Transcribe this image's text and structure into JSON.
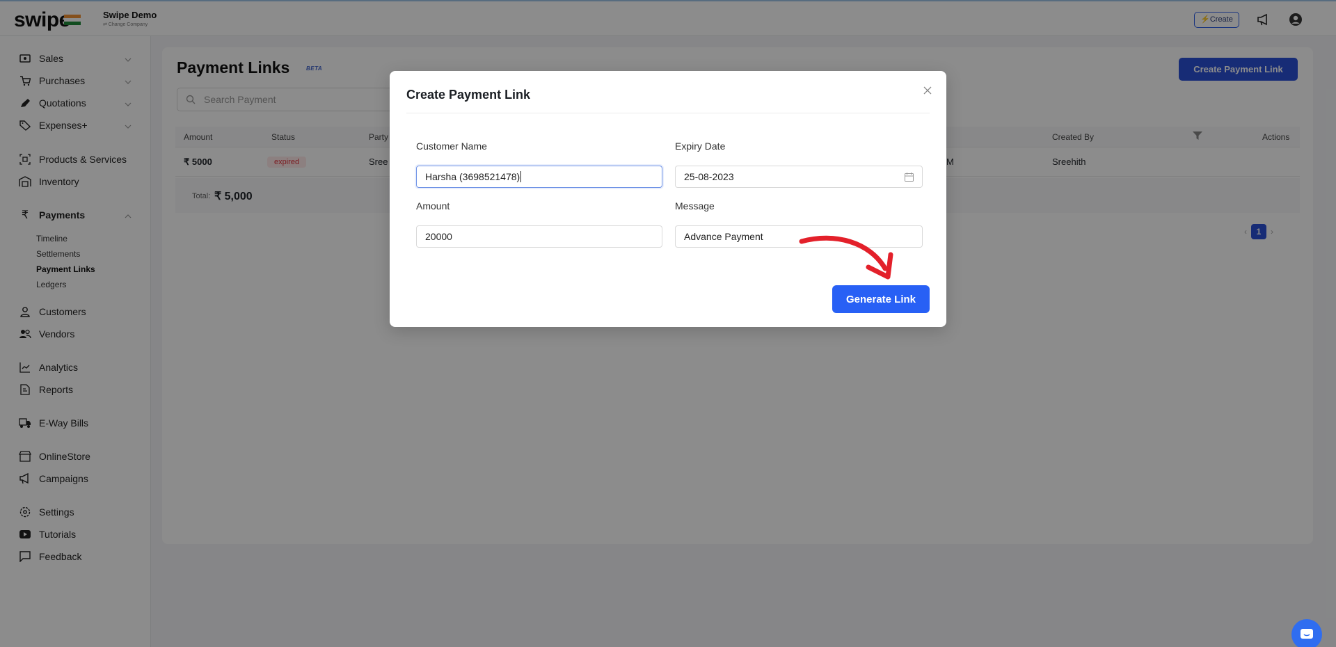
{
  "app": {
    "logo": "swipe",
    "company_name": "Swipe Demo",
    "change_company": "⇄ Change Company",
    "create_label": "⚡Create"
  },
  "sidebar": {
    "items": [
      {
        "label": "Sales",
        "icon": "cash-icon"
      },
      {
        "label": "Purchases",
        "icon": "cart-icon"
      },
      {
        "label": "Quotations",
        "icon": "pen-icon"
      },
      {
        "label": "Expenses+",
        "icon": "tag-icon"
      },
      {
        "label": "Products & Services",
        "icon": "box-icon"
      },
      {
        "label": "Inventory",
        "icon": "warehouse-icon"
      },
      {
        "label": "Payments",
        "icon": "rupee-icon"
      },
      {
        "label": "Customers",
        "icon": "user-icon"
      },
      {
        "label": "Vendors",
        "icon": "users-icon"
      },
      {
        "label": "Analytics",
        "icon": "chart-icon"
      },
      {
        "label": "Reports",
        "icon": "report-icon"
      },
      {
        "label": "E-Way Bills",
        "icon": "truck-icon"
      },
      {
        "label": "OnlineStore",
        "icon": "store-icon"
      },
      {
        "label": "Campaigns",
        "icon": "megaphone-icon"
      },
      {
        "label": "Settings",
        "icon": "gear-icon"
      },
      {
        "label": "Tutorials",
        "icon": "play-icon"
      },
      {
        "label": "Feedback",
        "icon": "chat-icon"
      }
    ],
    "payments_sub": [
      "Timeline",
      "Settlements",
      "Payment Links",
      "Ledgers"
    ]
  },
  "page": {
    "title": "Payment Links",
    "beta": "BETA",
    "create_button": "Create Payment Link",
    "search_placeholder": "Search Payment",
    "columns": {
      "amount": "Amount",
      "status": "Status",
      "party": "Party",
      "created_by": "Created By",
      "actions": "Actions"
    },
    "row": {
      "amount": "₹ 5000",
      "status": "expired",
      "party": "Sree",
      "time_fragment": "M",
      "created_by": "Sreehith"
    },
    "total_label": "Total:",
    "total_value": "₹ 5,000",
    "current_page": "1"
  },
  "modal": {
    "title": "Create Payment Link",
    "customer_name_label": "Customer Name",
    "customer_name_value": "Harsha (3698521478)",
    "expiry_date_label": "Expiry Date",
    "expiry_date_value": "25-08-2023",
    "amount_label": "Amount",
    "amount_value": "20000",
    "message_label": "Message",
    "message_value": "Advance Payment",
    "generate_button": "Generate Link"
  },
  "colors": {
    "primary": "#2b50d8",
    "generate_button": "#2860f5",
    "expired_text": "#e0323c",
    "arrow": "#e3202a"
  }
}
